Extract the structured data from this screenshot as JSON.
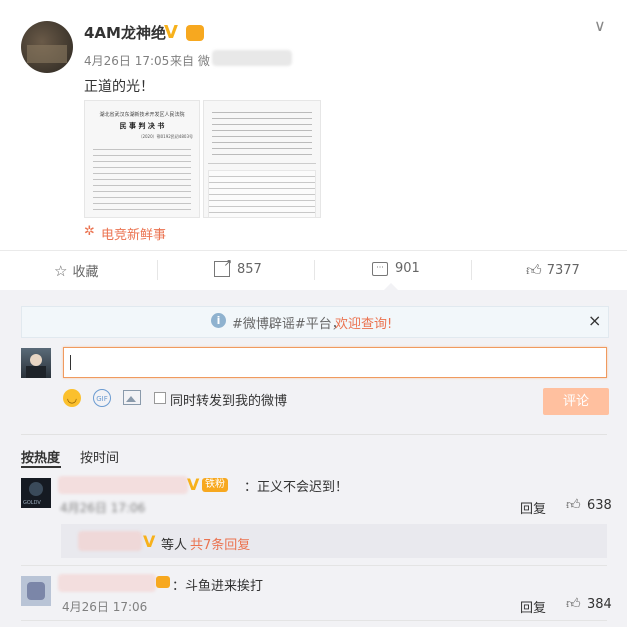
{
  "post": {
    "author": "4AM龙神绝",
    "date": "4月26日 17:05",
    "source_prefix": "来自 微",
    "text": "正道的光！",
    "doc1": {
      "court": "湖北省武汉东湖新技术开发区人民法院",
      "title": "民 事 判 决 书",
      "case_no": "（2020）鄂0192民初4803号"
    },
    "topic": "电竞新鲜事",
    "menu_label": "∨"
  },
  "actions": {
    "favorite": "收藏",
    "repost": "857",
    "comments": "901",
    "likes": "7377"
  },
  "notice": {
    "tag": "#微博辟谣#平台，",
    "link": "欢迎查询!",
    "close": "×"
  },
  "composer": {
    "input_value": "",
    "sync_label": "同时转发到我的微博",
    "submit": "评论"
  },
  "sort": {
    "hot": "按热度",
    "time": "按时间"
  },
  "comments": [
    {
      "badge": "铁粉",
      "text": "：正义不会迟到！",
      "date_blur": "4月26日 17:06",
      "reply": "回复",
      "likes": "638",
      "sub": {
        "text": "等人",
        "count": "共7条回复"
      }
    },
    {
      "text": "：斗鱼进来挨打",
      "date": "4月26日 17:06",
      "reply": "回复",
      "likes": "384"
    }
  ],
  "colors": {
    "accent": "#eb7350",
    "link": "#eb7350",
    "vip": "#f7b11b",
    "notice_bg": "#f2f7fa",
    "submit_bg": "#ffc09f"
  }
}
